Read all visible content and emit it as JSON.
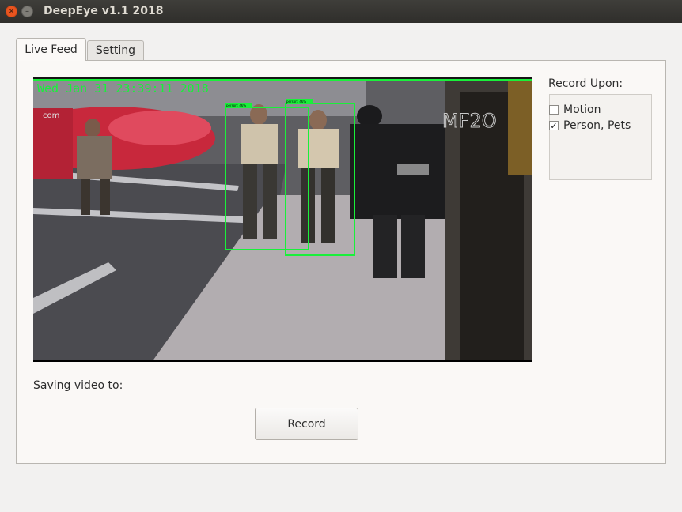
{
  "window": {
    "title": "DeepEye v1.1 2018",
    "close_glyph": "×",
    "minimize_glyph": "–"
  },
  "tabs": [
    {
      "label": "Live Feed",
      "active": true
    },
    {
      "label": "Setting",
      "active": false
    }
  ],
  "feed": {
    "timestamp": "Wed Jan 31 23:39:11 2018",
    "watermark": "MF2O",
    "corner_logo": "com",
    "overlay_color": "#19f03a",
    "detections": [
      {
        "label": "person: 46%"
      },
      {
        "label": "person: 46%"
      }
    ]
  },
  "record_upon": {
    "label": "Record Upon:",
    "options": [
      {
        "label": "Motion",
        "checked": false,
        "mark": ""
      },
      {
        "label": "Person, Pets",
        "checked": true,
        "mark": "✓"
      }
    ]
  },
  "saving": {
    "label": "Saving video to:"
  },
  "record_button": {
    "label": "Record"
  }
}
